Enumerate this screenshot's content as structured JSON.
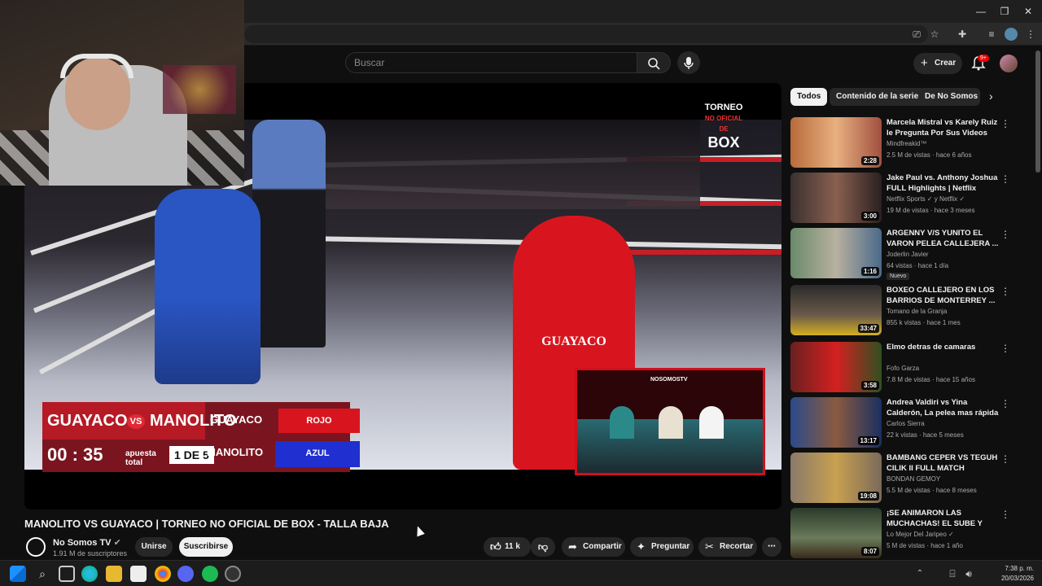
{
  "search": {
    "placeholder": "Buscar"
  },
  "header": {
    "create_label": "Crear",
    "notif_count": "9+"
  },
  "video": {
    "title": "MANOLITO VS GUAYACO | TORNEO NO OFICIAL DE BOX - TALLA BAJA",
    "channel": "No Somos TV",
    "subscribers": "1.91 M de suscriptores",
    "join_label": "Unirse",
    "subscribe_label": "Suscribirse",
    "likes": "11 k",
    "share_label": "Compartir",
    "ask_label": "Preguntar",
    "clip_label": "Recortar"
  },
  "overlay": {
    "logo_line1": "TORNEO",
    "logo_line2": "NO OFICIAL DE",
    "logo_line3": "BOX",
    "fighter_a": "GUAYACO",
    "fighter_b": "MANOLITO",
    "vs": "VS",
    "timer": "00 : 35",
    "sponsor": "apuesta total",
    "round": "1 DE 5",
    "corner_a": "ROJO",
    "corner_b": "AZUL",
    "pip_brand": "NOSOMOSTV"
  },
  "chips": [
    "Todos",
    "Contenido de la serie",
    "De No Somos TV"
  ],
  "recommendations": [
    {
      "title": "Marcela Mistral vs Karely Ruiz le Pregunta Por Sus Videos En...",
      "channel": "Mindfreakid™",
      "meta": "2.5 M de vistas · hace 6 años",
      "duration": "2:28",
      "badge": ""
    },
    {
      "title": "Jake Paul vs. Anthony Joshua FULL Highlights | Netflix",
      "channel": "Netflix Sports ✓ y Netflix ✓",
      "meta": "19 M de vistas · hace 3 meses",
      "duration": "3:00",
      "badge": ""
    },
    {
      "title": "ARGENNY V/S YUNITO EL VARON PELEA CALLEJERA ...",
      "channel": "Joderlin Javier",
      "meta": "64 vistas · hace 1 día",
      "duration": "1:16",
      "badge": "Nuevo"
    },
    {
      "title": "BOXEO CALLEJERO EN LOS BARRIOS DE MONTERREY ...",
      "channel": "Tomano de la Granja",
      "meta": "855 k vistas · hace 1 mes",
      "duration": "33:47",
      "badge": ""
    },
    {
      "title": "Elmo detras de camaras",
      "channel": "Fofo Garza",
      "meta": "7.8 M de vistas · hace 15 años",
      "duration": "3:58",
      "badge": ""
    },
    {
      "title": "Andrea Valdiri vs Yina Calderón, La pelea mas rápida",
      "channel": "Carlos Sierra",
      "meta": "22 k vistas · hace 5 meses",
      "duration": "13:17",
      "badge": ""
    },
    {
      "title": "BAMBANG CEPER VS TEGUH CILIK II FULL MATCH SHADUK...",
      "channel": "BONDAN GEMOY",
      "meta": "5.5 M de vistas · hace 8 meses",
      "duration": "19:08",
      "badge": ""
    },
    {
      "title": "¡SE ANIMARON LAS MUCHACHAS! EL SUBE Y BAJ...",
      "channel": "Lo Mejor Del Jaripeo ✓",
      "meta": "5 M de vistas · hace 1 año",
      "duration": "8:07",
      "badge": ""
    }
  ],
  "taskbar": {
    "time": "7:38 p. m.",
    "date": "20/03/2026"
  },
  "colors": {
    "accent_red": "#c81e26",
    "corner_red": "#d8151f",
    "corner_blue": "#1f2fd0"
  }
}
